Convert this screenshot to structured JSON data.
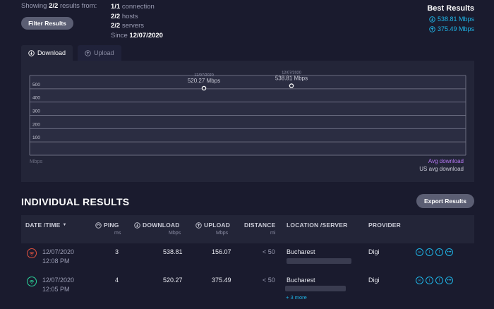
{
  "summary": {
    "showing_prefix": "Showing",
    "showing_count": "2/2",
    "showing_suffix": "results from:",
    "filter_button": "Filter Results",
    "connections_count": "1/1",
    "connections_label": "connection",
    "hosts_count": "2/2",
    "hosts_label": "hosts",
    "servers_count": "2/2",
    "servers_label": "servers",
    "since_label": "Since",
    "since_date": "12/07/2020"
  },
  "best_results": {
    "title": "Best Results",
    "download": "538.81 Mbps",
    "upload": "375.49 Mbps"
  },
  "tabs": [
    {
      "label": "Download",
      "icon": "download-circle-icon"
    },
    {
      "label": "Upload",
      "icon": "upload-circle-icon"
    }
  ],
  "chart_data": {
    "type": "scatter",
    "title": "",
    "xlabel": "",
    "ylabel": "Mbps",
    "ylim": [
      0,
      600
    ],
    "yticks": [
      100,
      200,
      300,
      400,
      500
    ],
    "grid": true,
    "points": [
      {
        "date": "12/07/2020",
        "label": "520.27 Mbps",
        "value": 520.27,
        "order": 1
      },
      {
        "date": "12/07/2020",
        "label": "538.81 Mbps",
        "value": 538.81,
        "order": 2
      }
    ],
    "legend": [
      "Avg download",
      "US avg download"
    ],
    "legend_colors": [
      "#b477f2",
      "#c9cad6"
    ],
    "legend_position": "bottom-right"
  },
  "results": {
    "title": "INDIVIDUAL RESULTS",
    "export_button": "Export Results",
    "columns": [
      {
        "label": "DATE /TIME",
        "unit": "",
        "icon": "chevron-down-icon"
      },
      {
        "label": "PING",
        "unit": "ms",
        "icon": "ping-icon"
      },
      {
        "label": "DOWNLOAD",
        "unit": "Mbps",
        "icon": "download-circle-icon"
      },
      {
        "label": "UPLOAD",
        "unit": "Mbps",
        "icon": "upload-circle-icon"
      },
      {
        "label": "DISTANCE",
        "unit": "mi",
        "icon": ""
      },
      {
        "label": "LOCATION /SERVER",
        "unit": "",
        "icon": ""
      },
      {
        "label": "PROVIDER",
        "unit": "",
        "icon": ""
      }
    ],
    "rows": [
      {
        "date": "12/07/2020",
        "time": "12:08 PM",
        "ping": "3",
        "download": "538.81",
        "upload": "156.07",
        "distance": "< 50",
        "location": "Bucharest",
        "provider": "Digi",
        "status_color": "#e0523f",
        "more": ""
      },
      {
        "date": "12/07/2020",
        "time": "12:05 PM",
        "ping": "4",
        "download": "520.27",
        "upload": "375.49",
        "distance": "< 50",
        "location": "Bucharest",
        "provider": "Digi",
        "status_color": "#2bd69b",
        "more": "+ 3 more"
      }
    ]
  },
  "colors": {
    "background": "#1a1b2e",
    "panel": "#232538",
    "accent": "#1fb4e6",
    "button": "#5b5e73"
  }
}
